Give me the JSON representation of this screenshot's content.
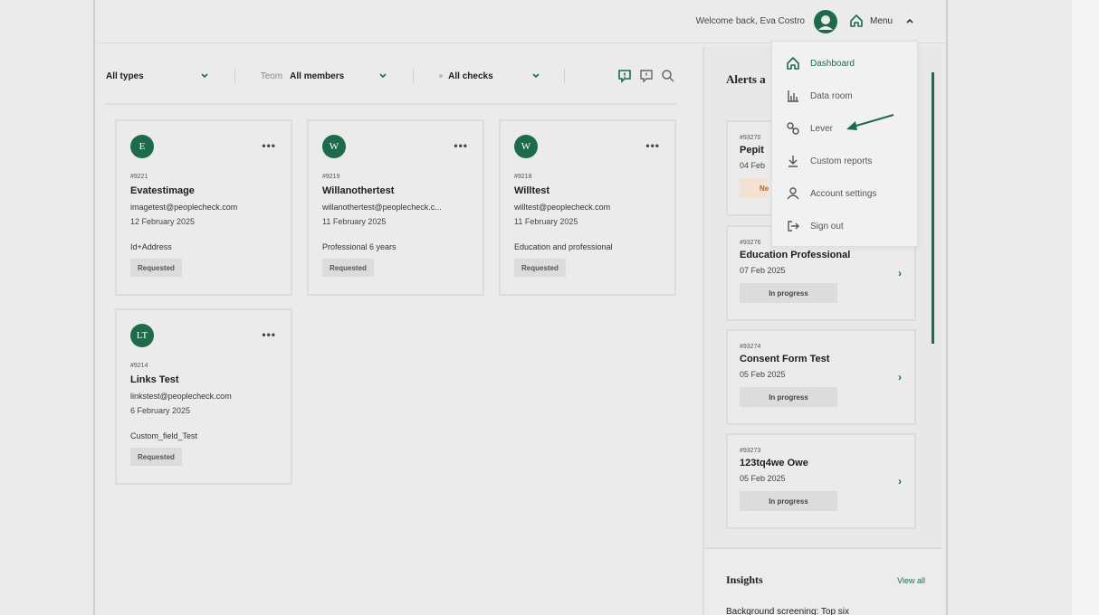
{
  "header": {
    "welcome": "Welcome back, Eva Costro",
    "menu_label": "Menu"
  },
  "filters": [
    {
      "label": "",
      "value": "All types"
    },
    {
      "label": "Teom",
      "value": "All members"
    },
    {
      "label": "",
      "value": "All checks"
    }
  ],
  "cards": [
    {
      "initials": "E",
      "id": "#9221",
      "name": "Evatestimage",
      "email": "imagetest@peoplecheck.com",
      "date": "12 February 2025",
      "check": "Id+Address",
      "status": "Requested"
    },
    {
      "initials": "W",
      "id": "#9219",
      "name": "Willanothertest",
      "email": "willanothertest@peoplecheck.c...",
      "date": "11 February 2025",
      "check": "Professional 6 years",
      "status": "Requested"
    },
    {
      "initials": "W",
      "id": "#9218",
      "name": "Willtest",
      "email": "willtest@peoplecheck.com",
      "date": "11 February 2025",
      "check": "Education and professional",
      "status": "Requested"
    },
    {
      "initials": "LT",
      "id": "#9214",
      "name": "Links Test",
      "email": "linkstest@peoplecheck.com",
      "date": "6 February 2025",
      "check": "Custom_field_Test",
      "status": "Requested"
    }
  ],
  "alerts": {
    "title": "Alerts a",
    "items": [
      {
        "id": "#93270",
        "name": "Pepit",
        "date": "04 Feb",
        "status": "Ne"
      },
      {
        "id": "#93276",
        "name": "Education Professional",
        "date": "07 Feb 2025",
        "status": "In progress"
      },
      {
        "id": "#93274",
        "name": "Consent Form Test",
        "date": "05 Feb 2025",
        "status": "In progress"
      },
      {
        "id": "#93273",
        "name": "123tq4we Owe",
        "date": "05 Feb 2025",
        "status": "In progress"
      }
    ]
  },
  "insights": {
    "title": "Insights",
    "view_all": "View all",
    "text": "Background screening: Top six"
  },
  "menu_items": [
    {
      "label": "Dashboard",
      "icon": "home-icon",
      "active": true
    },
    {
      "label": "Data room",
      "icon": "bar-chart-icon",
      "active": false
    },
    {
      "label": "Lever",
      "icon": "link-icon",
      "active": false
    },
    {
      "label": "Custom reports",
      "icon": "download-icon",
      "active": false
    },
    {
      "label": "Account settings",
      "icon": "user-icon",
      "active": false
    },
    {
      "label": "Sign out",
      "icon": "sign-out-icon",
      "active": false
    }
  ],
  "colors": {
    "brand": "#1e6b4c",
    "background": "#ebebeb"
  }
}
